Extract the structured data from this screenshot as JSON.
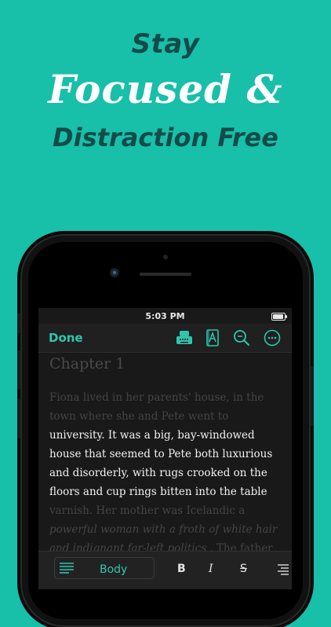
{
  "headline": {
    "line1": "Stay",
    "line2": "Focused &",
    "line3": "Distraction Free"
  },
  "status_bar": {
    "time": "5:03 PM"
  },
  "navbar": {
    "done_label": "Done",
    "icons": [
      "typewriter-icon",
      "book-icon",
      "search-icon",
      "more-icon"
    ]
  },
  "document": {
    "chapter_title": "Chapter 1",
    "lines": [
      {
        "text": "Fiona lived in her parents' house, in the",
        "style": "dim"
      },
      {
        "text": "town where she and Pete went to",
        "style": "dim"
      },
      {
        "text": "university. It was a big, bay-windowed",
        "style": "bright"
      },
      {
        "text": "house that seemed to Pete both luxurious",
        "style": "bright"
      },
      {
        "text": "and disorderly, with rugs crooked on the",
        "style": "bright"
      },
      {
        "text": "floors and cup rings bitten into the table",
        "style": "bright"
      },
      {
        "text": "varnish. Her mother was Icelandic a",
        "style": "dim"
      },
      {
        "text": "powerful woman with a froth of white hair",
        "style": "em"
      },
      {
        "text": "and indignant far-left politics . The father",
        "style": "mixed"
      }
    ],
    "line8_italic": "and indignant far-left politics",
    "line8_rest": " . The father"
  },
  "toolbar": {
    "paragraph_style": "Body",
    "bold": "B",
    "italic": "I",
    "strike": "S"
  },
  "colors": {
    "background": "#18bfa9",
    "accent": "#2fc6ad",
    "headline_dark": "#134b4a"
  }
}
